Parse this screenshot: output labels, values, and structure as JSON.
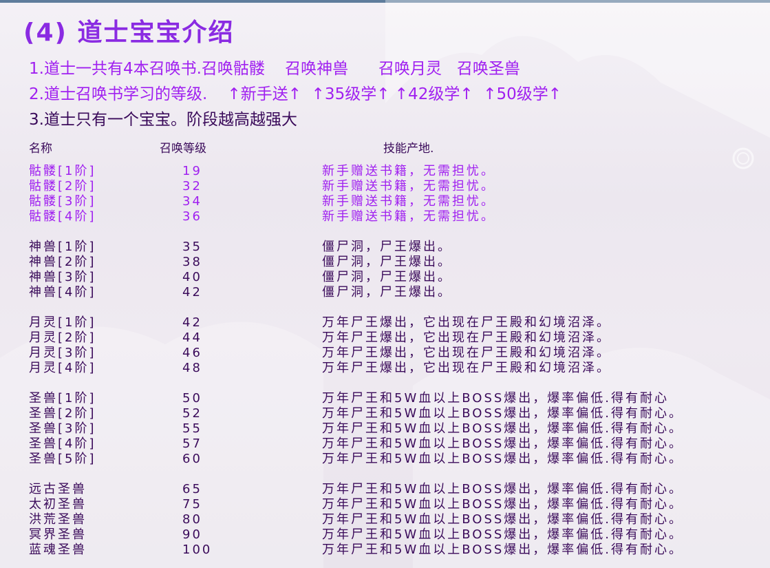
{
  "title": "(4) 道士宝宝介绍",
  "intro": [
    "1.道士一共有4本召唤书.召唤骷髅    召唤神兽      召唤月灵   召唤圣兽",
    "2.道士召唤书学习的等级.    ↑新手送↑  ↑35级学↑ ↑42级学↑  ↑50级学↑",
    "3.道士只有一个宝宝。阶段越高越强大"
  ],
  "headers": {
    "name": "名称",
    "level": "召唤等级",
    "source": "技能产地."
  },
  "rows": [
    {
      "name": "骷髅[1阶]",
      "level": "19",
      "source": "新手赠送书籍，无需担忧。"
    },
    {
      "name": "骷髅[2阶]",
      "level": "32",
      "source": "新手赠送书籍，无需担忧。"
    },
    {
      "name": "骷髅[3阶]",
      "level": "34",
      "source": "新手赠送书籍，无需担忧。"
    },
    {
      "name": "骷髅[4阶]",
      "level": "36",
      "source": "新手赠送书籍，无需担忧。"
    },
    {
      "name": "神兽[1阶]",
      "level": "35",
      "source": "僵尸洞，尸王爆出。"
    },
    {
      "name": "神兽[2阶]",
      "level": "38",
      "source": "僵尸洞，尸王爆出。"
    },
    {
      "name": "神兽[3阶]",
      "level": "40",
      "source": "僵尸洞，尸王爆出。"
    },
    {
      "name": "神兽[4阶]",
      "level": "42",
      "source": "僵尸洞，尸王爆出。"
    },
    {
      "name": "月灵[1阶]",
      "level": "42",
      "source": "万年尸王爆出，它出现在尸王殿和幻境沼泽。"
    },
    {
      "name": "月灵[2阶]",
      "level": "44",
      "source": "万年尸王爆出，它出现在尸王殿和幻境沼泽。"
    },
    {
      "name": "月灵[3阶]",
      "level": "46",
      "source": "万年尸王爆出，它出现在尸王殿和幻境沼泽。"
    },
    {
      "name": "月灵[4阶]",
      "level": "48",
      "source": "万年尸王爆出，它出现在尸王殿和幻境沼泽。"
    },
    {
      "name": "圣兽[1阶]",
      "level": "50",
      "source": "万年尸王和5W血以上BOSS爆出，爆率偏低.得有耐心"
    },
    {
      "name": "圣兽[2阶]",
      "level": "52",
      "source": "万年尸王和5W血以上BOSS爆出，爆率偏低.得有耐心。"
    },
    {
      "name": "圣兽[3阶]",
      "level": "55",
      "source": "万年尸王和5W血以上BOSS爆出，爆率偏低.得有耐心。"
    },
    {
      "name": "圣兽[4阶]",
      "level": "57",
      "source": "万年尸王和5W血以上BOSS爆出，爆率偏低.得有耐心。"
    },
    {
      "name": "圣兽[5阶]",
      "level": "60",
      "source": "万年尸王和5W血以上BOSS爆出，爆率偏低.得有耐心。"
    },
    {
      "name": "远古圣兽",
      "level": "65",
      "source": "万年尸王和5W血以上BOSS爆出，爆率偏低.得有耐心。"
    },
    {
      "name": "太初圣兽",
      "level": "75",
      "source": "万年尸王和5W血以上BOSS爆出，爆率偏低.得有耐心。"
    },
    {
      "name": "洪荒圣兽",
      "level": "80",
      "source": "万年尸王和5W血以上BOSS爆出，爆率偏低.得有耐心。"
    },
    {
      "name": "冥界圣兽",
      "level": "90",
      "source": "万年尸王和5W血以上BOSS爆出，爆率偏低.得有耐心。"
    },
    {
      "name": "蓝魂圣兽",
      "level": "100",
      "source": "万年尸王和5W血以上BOSS爆出，爆率偏低.得有耐心。"
    }
  ],
  "colors": {
    "title": "#8a2be2",
    "accent": "#a020f0",
    "dark": "#3a0a5a",
    "topbar": "#5f7d9c"
  }
}
